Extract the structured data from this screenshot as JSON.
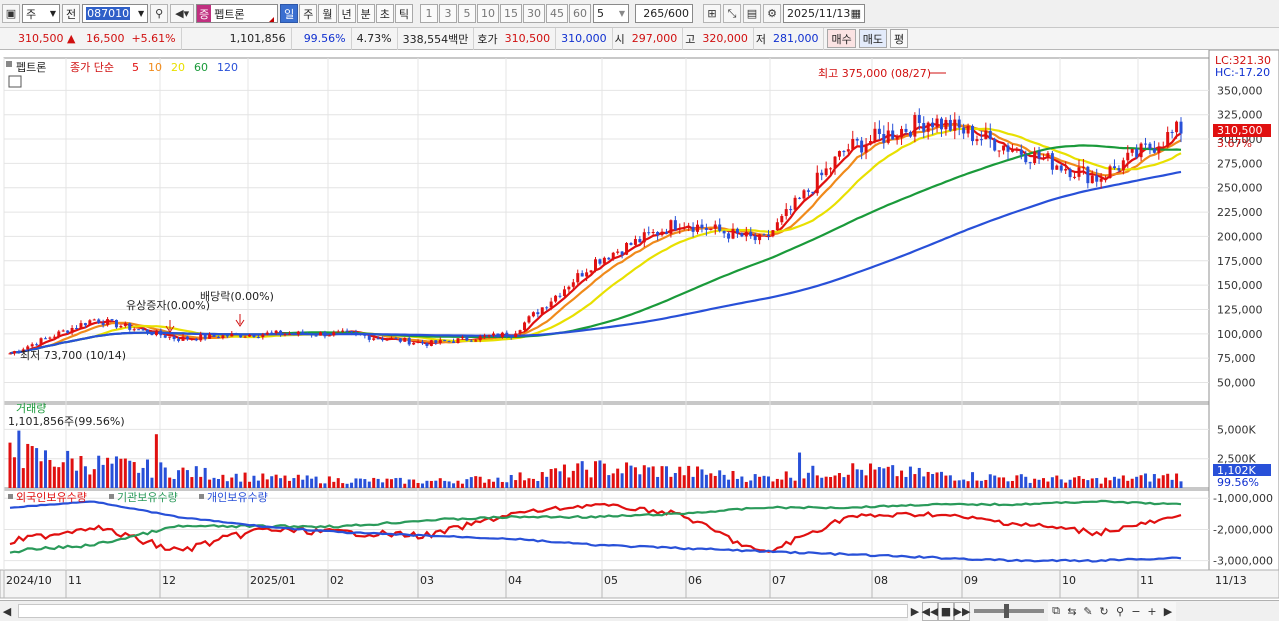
{
  "toolbar": {
    "period_type": "주",
    "prev_label": "전",
    "code": "087010",
    "stock_name": "펩트론",
    "stock_tag": "증",
    "periods": [
      "일",
      "주",
      "월",
      "년",
      "분",
      "초",
      "틱"
    ],
    "selected_period": "일",
    "intervals": [
      "1",
      "3",
      "5",
      "10",
      "15",
      "30",
      "45",
      "60"
    ],
    "interval_value": "5",
    "count_value": "265",
    "count_max": "/600",
    "date": "2025/11/13"
  },
  "quote": {
    "price": "310,500",
    "change": "16,500",
    "change_pct": "+5.61%",
    "volume": "1,101,856",
    "volume_ratio": "99.56%",
    "turnover_ratio": "4.73%",
    "amount": "338,554백만",
    "hoga_label": "호가",
    "ask": "310,500",
    "bid": "310,000",
    "open_label": "시",
    "open": "297,000",
    "high_label": "고",
    "high": "320,000",
    "low_label": "저",
    "low": "281,000",
    "buy_label": "매수",
    "sell_label": "매도",
    "avg_label": "평"
  },
  "price_panel": {
    "stock_name": "펩트론",
    "ma_label": "종가 단순",
    "ma_periods": [
      "5",
      "10",
      "20",
      "60",
      "120"
    ],
    "ma_colors": [
      "#e01010",
      "#f08a1a",
      "#e8e000",
      "#1a9a3a",
      "#2850d8"
    ],
    "lc_label": "LC:321.30",
    "hc_label": "HC:-17.20",
    "current_price": "310,500",
    "current_pct": "3.67%",
    "y_ticks": [
      "350,000",
      "325,000",
      "300,000",
      "275,000",
      "250,000",
      "225,000",
      "200,000",
      "175,000",
      "150,000",
      "125,000",
      "100,000",
      "75,000",
      "50,000"
    ],
    "annotations": {
      "high": "최고 375,000 (08/27)",
      "low": "최저 73,700 (10/14)",
      "rights": "유상증자(0.00%)",
      "dividend": "배당락(0.00%)"
    }
  },
  "volume_panel": {
    "title": "거래량",
    "value": "1,101,856주(99.56%)",
    "y_ticks": [
      "5,000K",
      "2,500K"
    ],
    "current": "1,102K",
    "current_pct": "99.56%"
  },
  "flow_panel": {
    "legend": [
      "외국인보유수량",
      "기관보유수량",
      "개인보유수량"
    ],
    "colors": [
      "#e01010",
      "#2a9a5a",
      "#2850d8"
    ],
    "y_ticks": [
      "-1,000,000",
      "-2,000,000",
      "-3,000,000"
    ]
  },
  "x_axis": {
    "labels": [
      "2024/10",
      "11",
      "12",
      "2025/01",
      "02",
      "03",
      "04",
      "05",
      "06",
      "07",
      "08",
      "09",
      "10",
      "11"
    ],
    "last_date": "11/13"
  },
  "chart_data": {
    "type": "candlestick",
    "dates": [
      "2024/10/14",
      "2024/11",
      "2024/12",
      "2025/01",
      "2025/02",
      "2025/03",
      "2025/04",
      "2025/05",
      "2025/06",
      "2025/07",
      "2025/08",
      "2025/08/27",
      "2025/09",
      "2025/10",
      "2025/11/13"
    ],
    "close": [
      80000,
      115000,
      95000,
      100000,
      100000,
      90000,
      100000,
      175000,
      215000,
      195000,
      290000,
      320000,
      290000,
      260000,
      310500
    ],
    "volume_k": [
      3000,
      2200,
      1500,
      900,
      700,
      600,
      900,
      1800,
      1500,
      900,
      1700,
      1200,
      900,
      700,
      1102
    ],
    "foreign_holding": [
      -2400000,
      -1900000,
      -2700000,
      -2000000,
      -2100000,
      -2200000,
      -1500000,
      -1200000,
      -1500000,
      -2800000,
      -1600000,
      -1500000,
      -1800000,
      -2100000,
      -1600000
    ],
    "institution_holding": [
      -2700000,
      -2500000,
      -1900000,
      -1900000,
      -1900000,
      -1700000,
      -1600000,
      -1600000,
      -1500000,
      -1300000,
      -1300000,
      -1200000,
      -1200000,
      -1100000,
      -1200000
    ],
    "individual_holding": [
      -1300000,
      -1100000,
      -1600000,
      -1900000,
      -2100000,
      -2200000,
      -2300000,
      -2500000,
      -2600000,
      -2700000,
      -2800000,
      -2900000,
      -3000000,
      -3000000,
      -2900000
    ],
    "y_range": [
      30000,
      375000
    ],
    "volume_range": [
      0,
      7000
    ],
    "flow_range": [
      -3300000,
      -800000
    ]
  }
}
